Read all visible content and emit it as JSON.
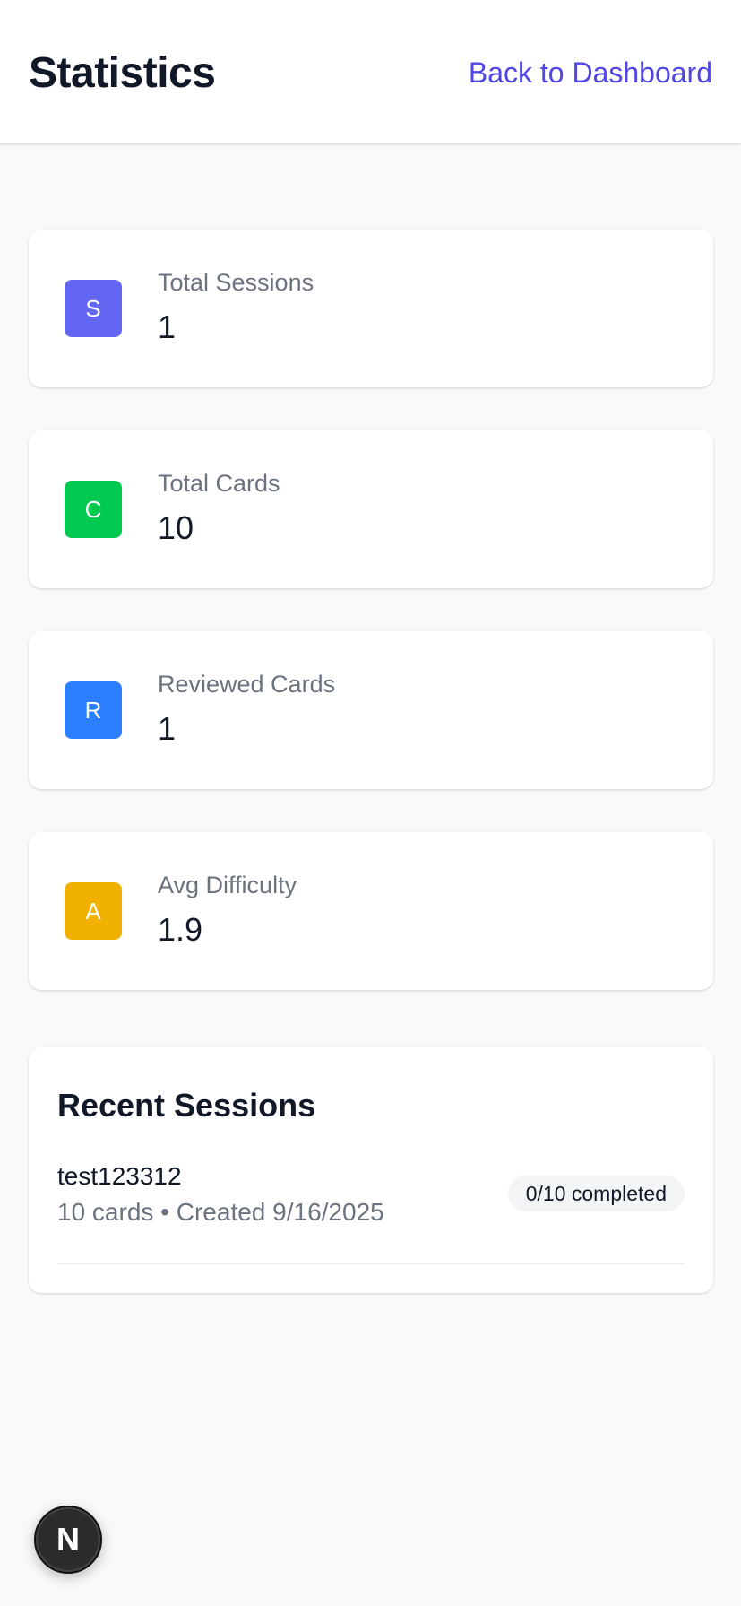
{
  "header": {
    "title": "Statistics",
    "back_link": "Back to Dashboard"
  },
  "stats": [
    {
      "icon_letter": "S",
      "icon_color": "#6366f1",
      "label": "Total Sessions",
      "value": "1"
    },
    {
      "icon_letter": "C",
      "icon_color": "#00c950",
      "label": "Total Cards",
      "value": "10"
    },
    {
      "icon_letter": "R",
      "icon_color": "#2b7fff",
      "label": "Reviewed Cards",
      "value": "1"
    },
    {
      "icon_letter": "A",
      "icon_color": "#f0b100",
      "label": "Avg Difficulty",
      "value": "1.9"
    }
  ],
  "recent_sessions": {
    "title": "Recent Sessions",
    "items": [
      {
        "name": "test123312",
        "meta": "10 cards • Created 9/16/2025",
        "badge": "0/10 completed"
      }
    ]
  },
  "dev_badge": {
    "letter": "N"
  }
}
